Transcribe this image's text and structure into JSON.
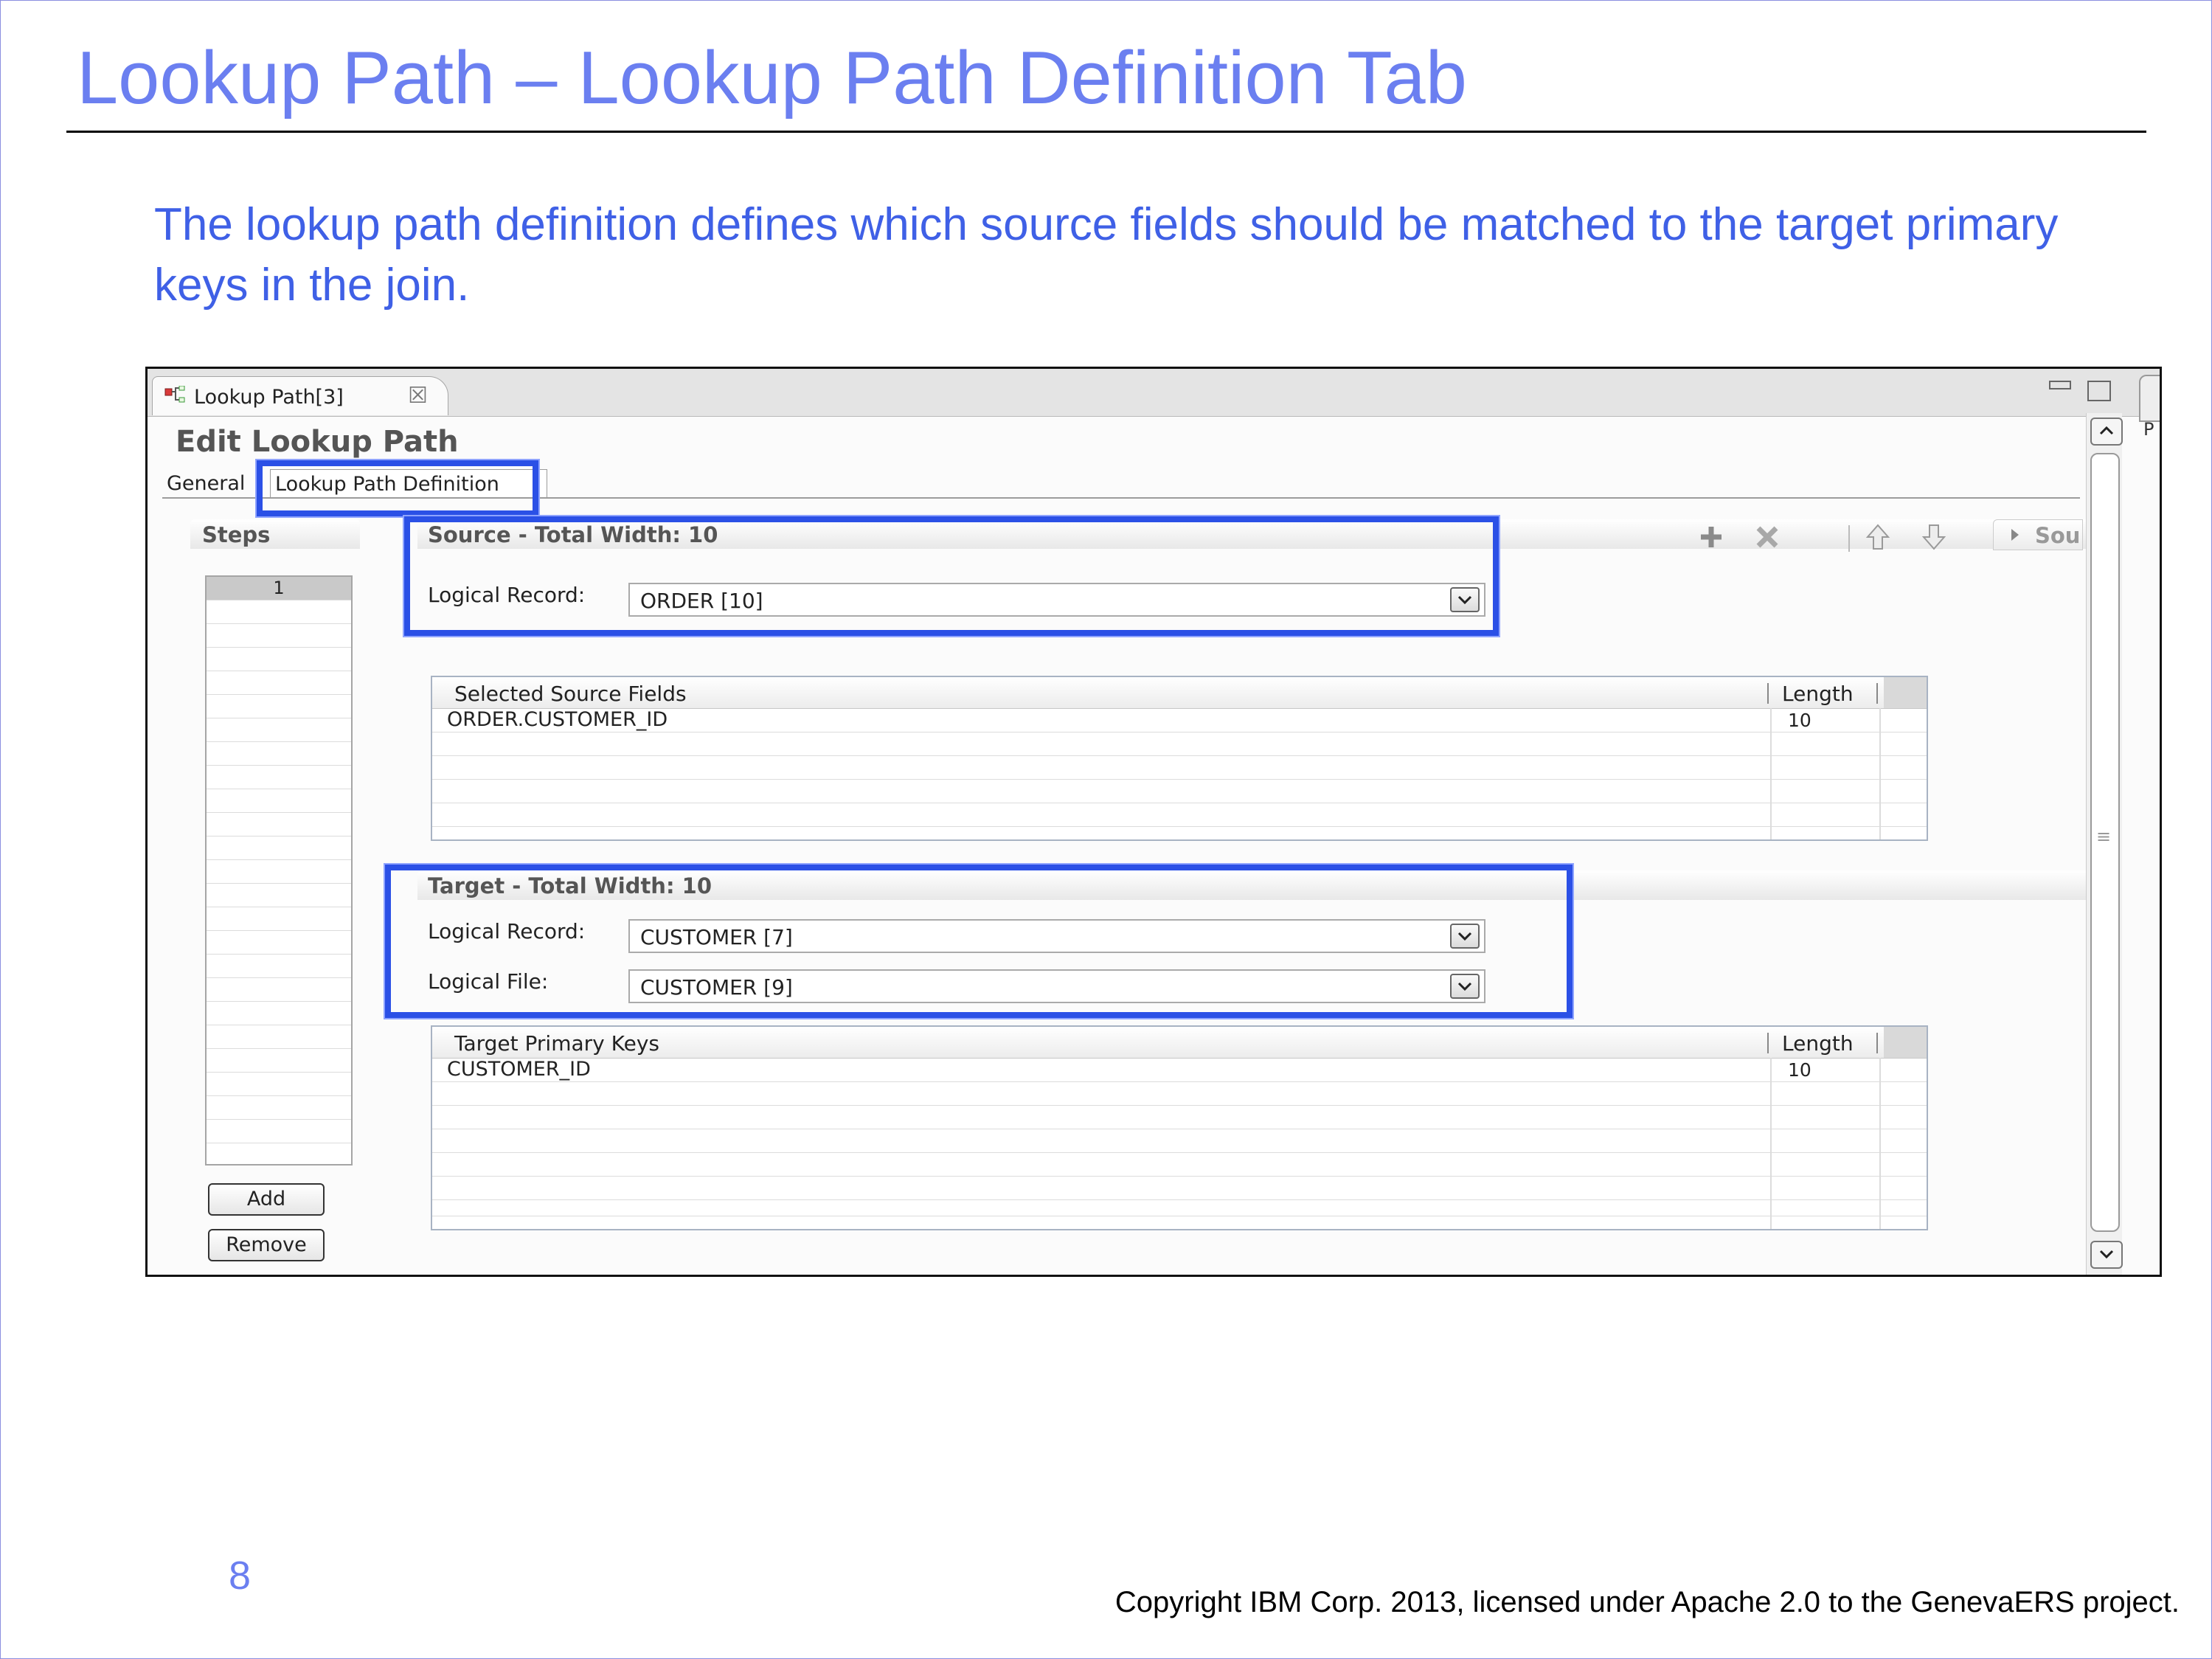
{
  "slide": {
    "title": "Lookup Path – Lookup Path Definition Tab",
    "description": "The lookup path definition defines which source fields should be matched to the target primary keys in the join.",
    "page_number": "8",
    "copyright": "Copyright IBM Corp. 2013, licensed under Apache 2.0 to the GenevaERS project."
  },
  "editor": {
    "tab_label": "Lookup Path[3]",
    "form_title": "Edit Lookup Path",
    "form_tabs": [
      {
        "label": "General"
      },
      {
        "label": "Lookup Path Definition"
      }
    ],
    "side_letter": "P"
  },
  "steps": {
    "label": "Steps",
    "items": [
      "1"
    ],
    "add_label": "Add",
    "remove_label": "Remove"
  },
  "source": {
    "title": "Source - Total Width: 10",
    "logical_record_label": "Logical Record:",
    "logical_record_value": "ORDER [10]",
    "grid": {
      "col1": "Selected Source Fields",
      "col2": "Length",
      "rows": [
        {
          "field": "ORDER.CUSTOMER_ID",
          "length": "10"
        }
      ]
    },
    "side_tab_label": "Sou"
  },
  "target": {
    "title": "Target - Total Width: 10",
    "logical_record_label": "Logical Record:",
    "logical_record_value": "CUSTOMER [7]",
    "logical_file_label": "Logical File:",
    "logical_file_value": "CUSTOMER [9]",
    "grid": {
      "col1": "Target Primary Keys",
      "col2": "Length",
      "rows": [
        {
          "field": "CUSTOMER_ID",
          "length": "10"
        }
      ]
    }
  },
  "toolbar": {
    "icons": [
      "add-icon",
      "delete-icon",
      "move-up-icon",
      "move-down-icon"
    ]
  },
  "colors": {
    "title": "#6b7ff0",
    "description": "#3f60e6",
    "highlight": "#2b50e6"
  }
}
